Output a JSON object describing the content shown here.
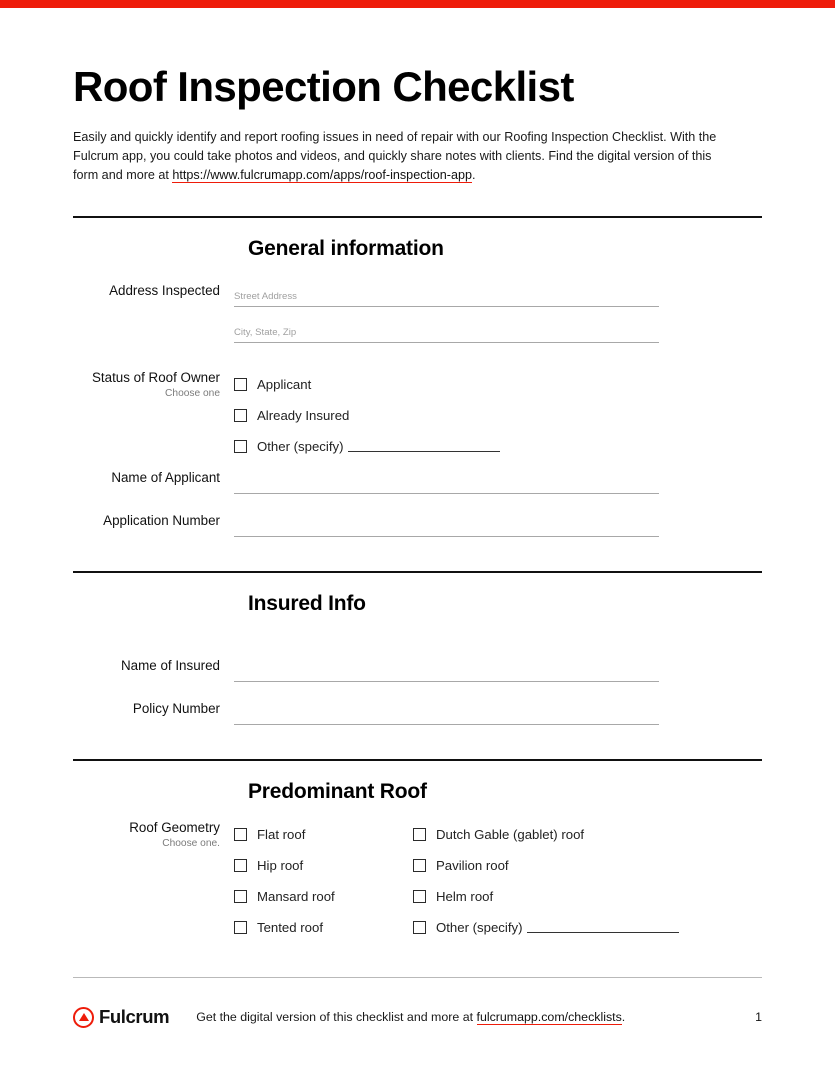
{
  "brand": {
    "accent_color": "#ee1c0a",
    "logo_text": "Fulcrum",
    "logo_icon": "circle-triangle-icon"
  },
  "header": {
    "title": "Roof Inspection Checklist",
    "intro_before_link": "Easily and quickly identify and report roofing issues in need of repair with our Roofing Inspection Checklist. With the Fulcrum app, you could take photos and videos, and quickly share notes with clients. Find the digital version of this form and more at ",
    "intro_link": "https://www.fulcrumapp.com/apps/roof-inspection-app",
    "intro_after_link": "."
  },
  "sections": {
    "general": {
      "heading": "General information",
      "address": {
        "label": "Address Inspected",
        "street_placeholder": "Street Address",
        "street_value": "",
        "citystatezip_placeholder": "City, State, Zip",
        "citystatezip_value": ""
      },
      "status": {
        "label": "Status of Roof Owner",
        "hint": "Choose one",
        "options": [
          {
            "label": "Applicant",
            "checked": false
          },
          {
            "label": "Already Insured",
            "checked": false
          },
          {
            "label": "Other (specify)",
            "checked": false,
            "has_specify_line": true
          }
        ]
      },
      "name_of_applicant": {
        "label": "Name of Applicant",
        "value": ""
      },
      "application_number": {
        "label": "Application Number",
        "value": ""
      }
    },
    "insured": {
      "heading": "Insured Info",
      "name_of_insured": {
        "label": "Name of Insured",
        "value": ""
      },
      "policy_number": {
        "label": "Policy Number",
        "value": ""
      }
    },
    "roof": {
      "heading": "Predominant Roof",
      "geometry": {
        "label": "Roof Geometry",
        "hint": "Choose one.",
        "left_options": [
          {
            "label": "Flat roof",
            "checked": false
          },
          {
            "label": "Hip roof",
            "checked": false
          },
          {
            "label": "Mansard roof",
            "checked": false
          },
          {
            "label": "Tented roof",
            "checked": false
          }
        ],
        "right_options": [
          {
            "label": "Dutch Gable (gablet) roof",
            "checked": false
          },
          {
            "label": "Pavilion roof",
            "checked": false
          },
          {
            "label": "Helm roof",
            "checked": false
          },
          {
            "label": "Other (specify)",
            "checked": false,
            "has_specify_line": true
          }
        ]
      }
    }
  },
  "footer": {
    "text_before_link": "Get the digital version of this checklist and more at ",
    "link": "fulcrumapp.com/checklists",
    "text_after_link": ".",
    "page_number": "1"
  }
}
